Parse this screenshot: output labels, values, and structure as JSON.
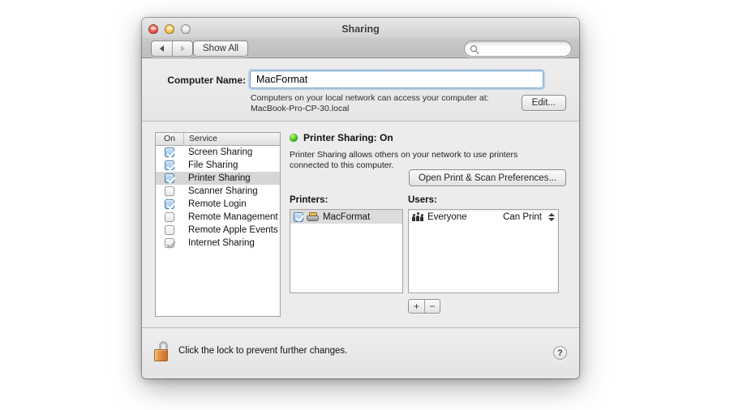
{
  "window": {
    "title": "Sharing",
    "traffic_lights": [
      "close",
      "minimize",
      "zoom"
    ]
  },
  "toolbar": {
    "back_label": "◀",
    "forward_label": "▶",
    "show_all_label": "Show All",
    "search_value": "",
    "search_placeholder": ""
  },
  "computer_name": {
    "label": "Computer Name:",
    "value": "MacFormat",
    "note_line1": "Computers on your local network can access your computer at:",
    "note_line2": "MacBook-Pro-CP-30.local",
    "edit_label": "Edit..."
  },
  "services": {
    "header_on": "On",
    "header_service": "Service",
    "items": [
      {
        "name": "Screen Sharing",
        "checked": true,
        "disabled": false,
        "selected": false
      },
      {
        "name": "File Sharing",
        "checked": true,
        "disabled": false,
        "selected": false
      },
      {
        "name": "Printer Sharing",
        "checked": true,
        "disabled": false,
        "selected": true
      },
      {
        "name": "Scanner Sharing",
        "checked": false,
        "disabled": false,
        "selected": false
      },
      {
        "name": "Remote Login",
        "checked": true,
        "disabled": false,
        "selected": false
      },
      {
        "name": "Remote Management",
        "checked": false,
        "disabled": false,
        "selected": false
      },
      {
        "name": "Remote Apple Events",
        "checked": false,
        "disabled": false,
        "selected": false
      },
      {
        "name": "Internet Sharing",
        "checked": true,
        "disabled": true,
        "selected": false
      }
    ]
  },
  "detail": {
    "status_title": "Printer Sharing: On",
    "status_color": "#3fc21a",
    "description": "Printer Sharing allows others on your network to use printers connected to this computer.",
    "open_prefs_label": "Open Print & Scan Preferences...",
    "printers_label": "Printers:",
    "users_label": "Users:",
    "printers": [
      {
        "name": "MacFormat",
        "checked": true,
        "selected": true
      }
    ],
    "users": [
      {
        "name": "Everyone",
        "permission": "Can Print"
      }
    ],
    "add_label": "+",
    "remove_label": "−"
  },
  "footer": {
    "lock_text": "Click the lock to prevent further changes.",
    "lock_state": "unlocked",
    "help_label": "?"
  }
}
